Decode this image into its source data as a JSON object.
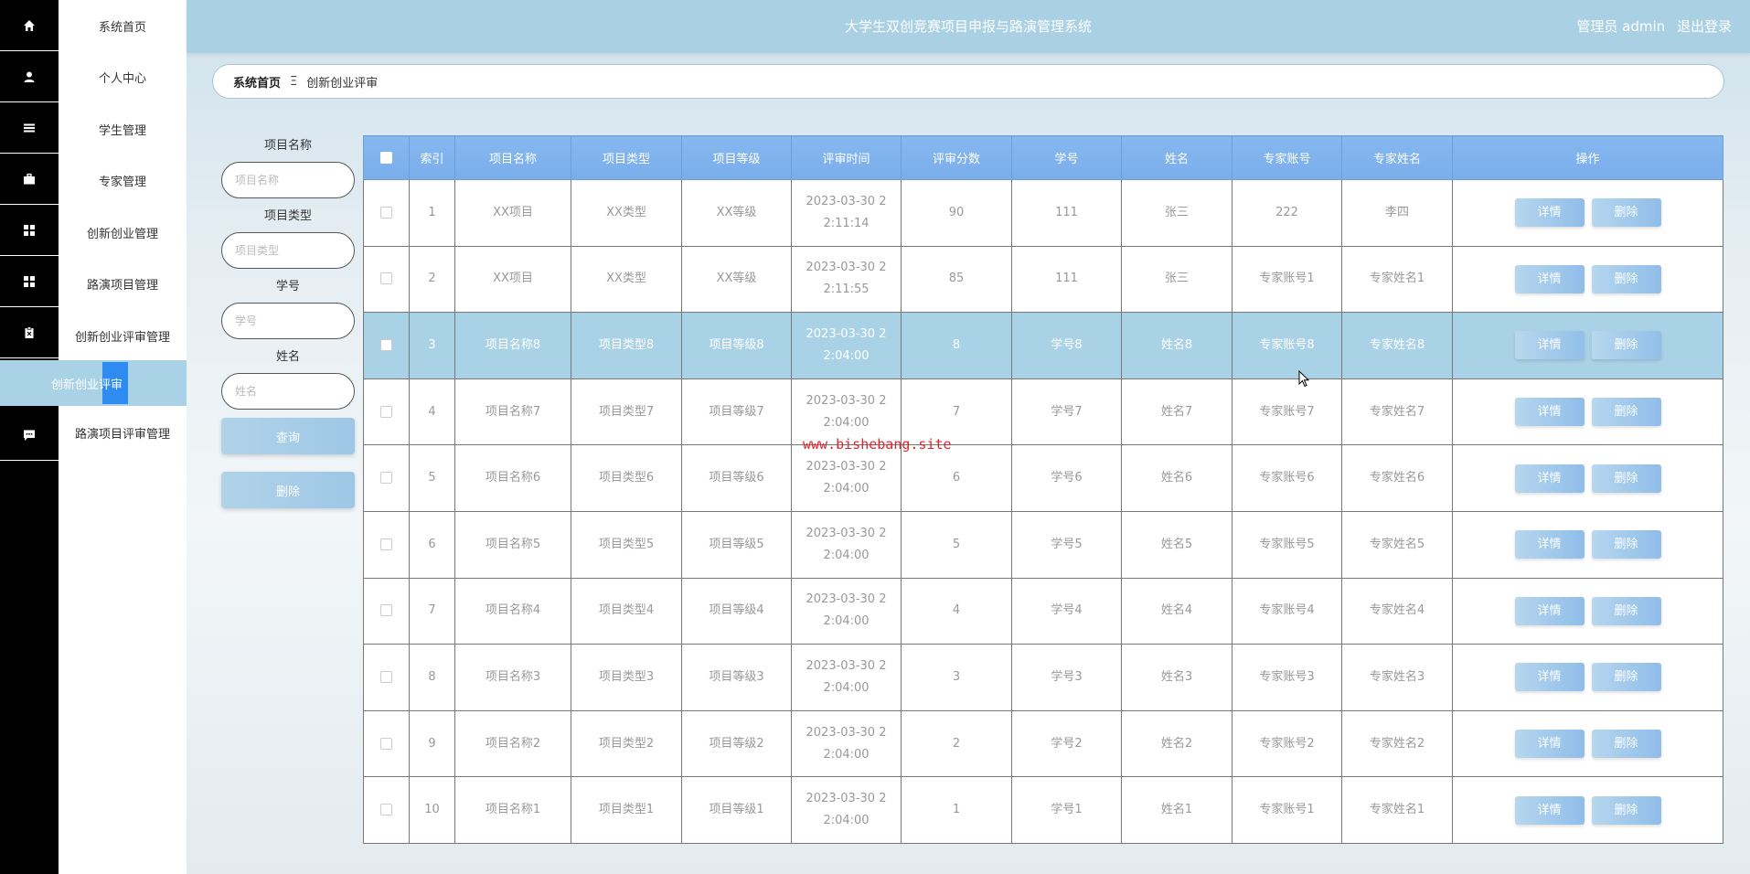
{
  "header": {
    "title": "大学生双创竞赛项目申报与路演管理系统",
    "user": "管理员 admin",
    "logout": "退出登录"
  },
  "rail_icons": [
    "home-icon",
    "user-icon",
    "list-icon",
    "briefcase-icon",
    "grid-icon",
    "grid-icon",
    "clipboard-icon",
    "",
    "chat-icon"
  ],
  "menu": {
    "items": [
      "系统首页",
      "个人中心",
      "学生管理",
      "专家管理",
      "创新创业管理",
      "路演项目管理",
      "创新创业评审管理",
      "路演项目评审管理"
    ],
    "active_sub": "创新创业评审"
  },
  "breadcrumb": {
    "home": "系统首页",
    "separator": "Ξ",
    "current": "创新创业评审"
  },
  "search": {
    "fields": [
      {
        "label": "项目名称",
        "placeholder": "项目名称"
      },
      {
        "label": "项目类型",
        "placeholder": "项目类型"
      },
      {
        "label": "学号",
        "placeholder": "学号"
      },
      {
        "label": "姓名",
        "placeholder": "姓名"
      }
    ],
    "query_btn": "查询",
    "delete_btn": "删除"
  },
  "table": {
    "columns": [
      "索引",
      "项目名称",
      "项目类型",
      "项目等级",
      "评审时间",
      "评审分数",
      "学号",
      "姓名",
      "专家账号",
      "专家姓名",
      "操作"
    ],
    "detail_label": "详情",
    "delete_label": "删除",
    "highlighted_row": 3,
    "rows": [
      [
        "1",
        "XX项目",
        "XX类型",
        "XX等级",
        "2023-03-30 22:11:14",
        "90",
        "111",
        "张三",
        "222",
        "李四"
      ],
      [
        "2",
        "XX项目",
        "XX类型",
        "XX等级",
        "2023-03-30 22:11:55",
        "85",
        "111",
        "张三",
        "专家账号1",
        "专家姓名1"
      ],
      [
        "3",
        "项目名称8",
        "项目类型8",
        "项目等级8",
        "2023-03-30 22:04:00",
        "8",
        "学号8",
        "姓名8",
        "专家账号8",
        "专家姓名8"
      ],
      [
        "4",
        "项目名称7",
        "项目类型7",
        "项目等级7",
        "2023-03-30 22:04:00",
        "7",
        "学号7",
        "姓名7",
        "专家账号7",
        "专家姓名7"
      ],
      [
        "5",
        "项目名称6",
        "项目类型6",
        "项目等级6",
        "2023-03-30 22:04:00",
        "6",
        "学号6",
        "姓名6",
        "专家账号6",
        "专家姓名6"
      ],
      [
        "6",
        "项目名称5",
        "项目类型5",
        "项目等级5",
        "2023-03-30 22:04:00",
        "5",
        "学号5",
        "姓名5",
        "专家账号5",
        "专家姓名5"
      ],
      [
        "7",
        "项目名称4",
        "项目类型4",
        "项目等级4",
        "2023-03-30 22:04:00",
        "4",
        "学号4",
        "姓名4",
        "专家账号4",
        "专家姓名4"
      ],
      [
        "8",
        "项目名称3",
        "项目类型3",
        "项目等级3",
        "2023-03-30 22:04:00",
        "3",
        "学号3",
        "姓名3",
        "专家账号3",
        "专家姓名3"
      ],
      [
        "9",
        "项目名称2",
        "项目类型2",
        "项目等级2",
        "2023-03-30 22:04:00",
        "2",
        "学号2",
        "姓名2",
        "专家账号2",
        "专家姓名2"
      ],
      [
        "10",
        "项目名称1",
        "项目类型1",
        "项目等级1",
        "2023-03-30 22:04:00",
        "1",
        "学号1",
        "姓名1",
        "专家账号1",
        "专家姓名1"
      ]
    ]
  },
  "watermark": "www.bishebang.site",
  "colors": {
    "header_bg": "#a9d0e3",
    "table_header": "#7aaeec",
    "highlight_row": "#a9d2e6",
    "active_marker": "#2e8bef",
    "watermark": "#e0242c"
  }
}
